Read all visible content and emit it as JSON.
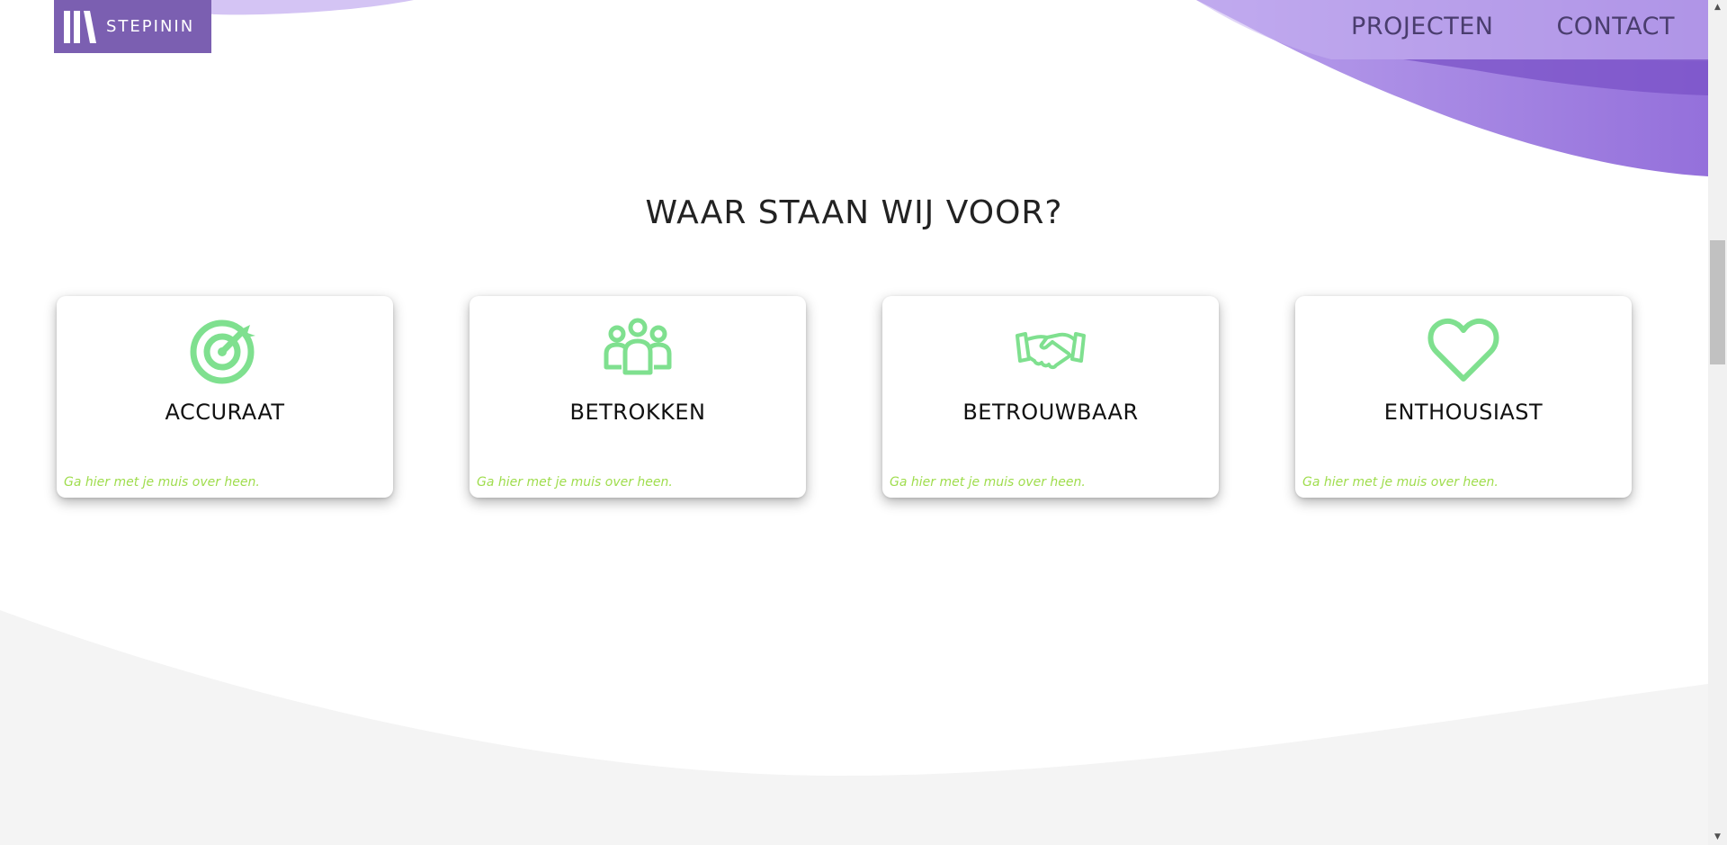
{
  "header": {
    "logo_text": "STEPININ",
    "nav": [
      {
        "label": "PROJECTEN"
      },
      {
        "label": "CONTACT"
      }
    ]
  },
  "section": {
    "title": "WAAR STAAN WIJ VOOR?"
  },
  "cards": [
    {
      "title": "ACCURAAT",
      "icon": "target-icon",
      "hint": "Ga hier met je muis over heen."
    },
    {
      "title": "BETROKKEN",
      "icon": "group-icon",
      "hint": "Ga hier met je muis over heen."
    },
    {
      "title": "BETROUWBAAR",
      "icon": "handshake-icon",
      "hint": "Ga hier met je muis over heen."
    },
    {
      "title": "ENTHOUSIAST",
      "icon": "heart-icon",
      "hint": "Ga hier met je muis over heen."
    }
  ],
  "colors": {
    "brand_purple": "#7b5fb1",
    "wave_purple": "#a98ae6",
    "icon_green": "#7fe08f",
    "hint_green": "#9fdd4d",
    "footer_gray": "#f4f4f4"
  }
}
